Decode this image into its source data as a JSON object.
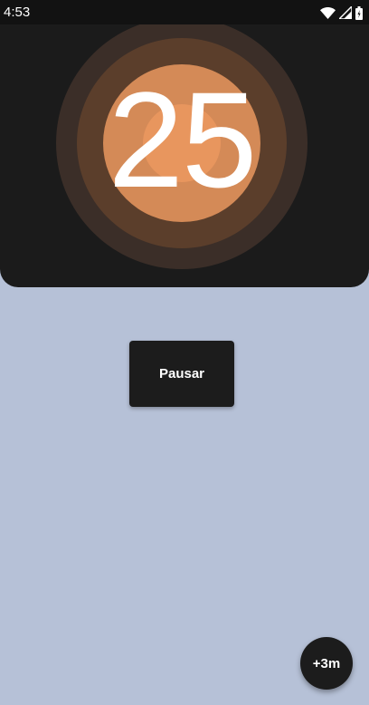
{
  "status_bar": {
    "time": "4:53",
    "icons": [
      "wifi-icon",
      "signal-icon",
      "battery-icon"
    ]
  },
  "timer": {
    "value": "25"
  },
  "controls": {
    "pause_label": "Pausar",
    "add_time_label": "+3m"
  },
  "colors": {
    "background": "#b6c1d7",
    "panel": "#1b1b1b",
    "accent": "#d48a57",
    "button": "#1c1c1c"
  }
}
